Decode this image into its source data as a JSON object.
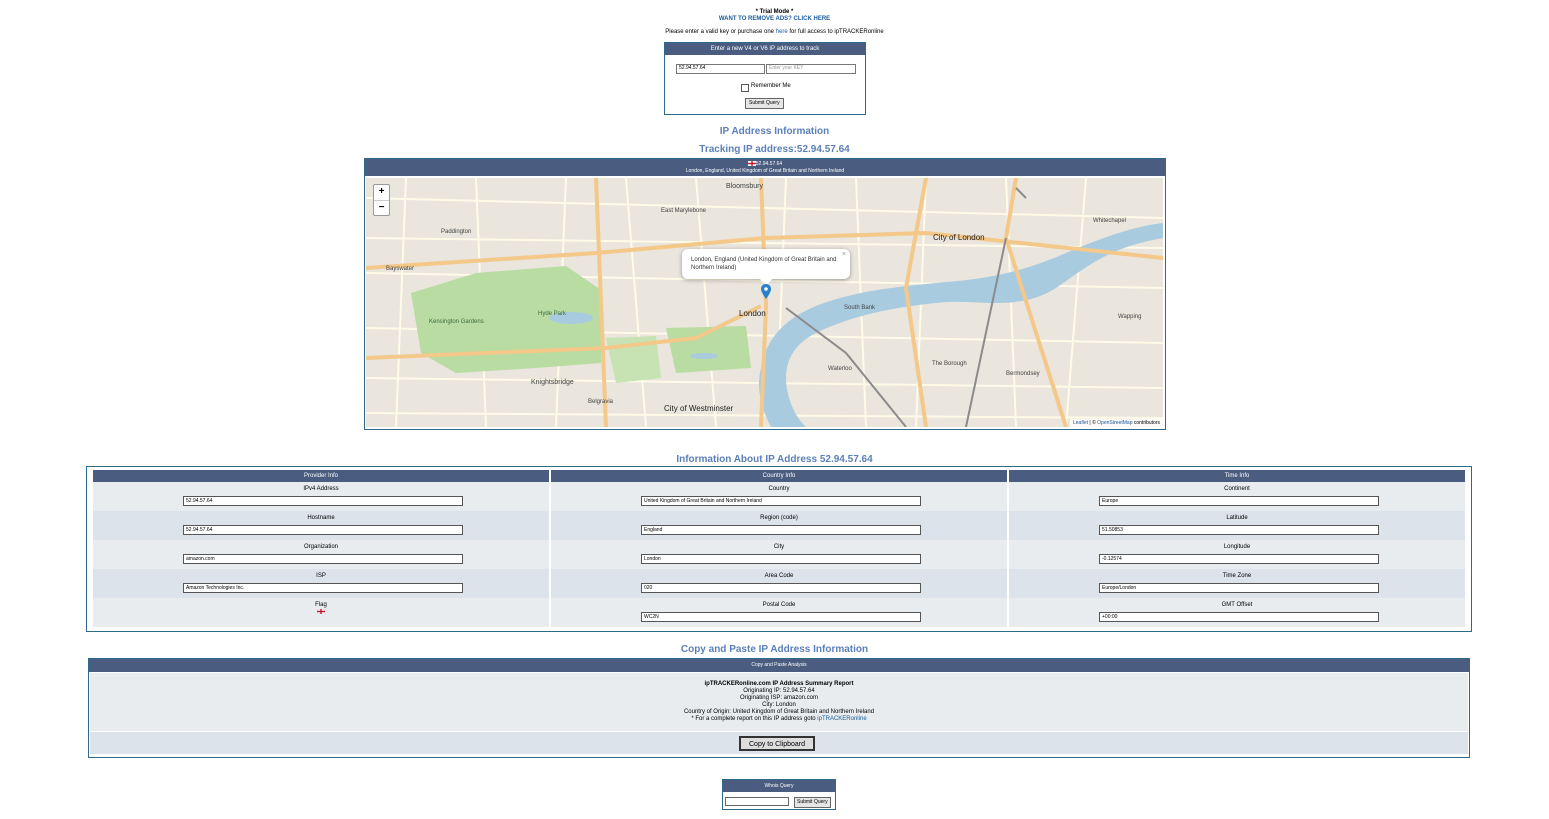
{
  "trial": {
    "title": "* Trial Mode *",
    "ads_link": "WANT TO REMOVE ADS? CLICK HERE",
    "notice_before": "Please enter a valid key or purchase one ",
    "notice_link": "here",
    "notice_after": " for full access to ipTRACKERonline"
  },
  "track_form": {
    "header": "Enter a new V4 or V6 IP address to track",
    "ip_value": "52.94.57.64",
    "key_placeholder": "Enter your KEY",
    "remember_label": "Remember Me",
    "submit_label": "Submit Query"
  },
  "headings": {
    "ip_info": "IP Address Information",
    "tracking": "Tracking IP address:52.94.57.64",
    "about": "Information About IP Address 52.94.57.64",
    "copy": "Copy and Paste IP Address Information"
  },
  "map": {
    "header_ip": "52.94.57.64",
    "header_location": "London, England, United Kingdom of Great Britain and Northern Ireland",
    "zoom_in": "+",
    "zoom_out": "−",
    "popup_text": "London, England (United Kingdom of Great Britain and Northern Ireland)",
    "popup_close": "×",
    "attribution_leaflet": "Leaflet",
    "attribution_sep": " | © ",
    "attribution_osm": "OpenStreetMap",
    "attribution_rest": " contributors",
    "labels": {
      "bloomsbury": "Bloomsbury",
      "marylebone": "East Marylebone",
      "city_of_london": "City of London",
      "london": "London",
      "hyde_park": "Hyde Park",
      "kensington_gardens": "Kensington Gardens",
      "city_of_westminster": "City of Westminster",
      "south_bank": "South Bank",
      "the_borough": "The Borough",
      "bayswater": "Bayswater",
      "knightsbridge": "Knightsbridge",
      "belgravia": "Belgravia",
      "whitechapel": "Whitechapel",
      "bermondsey": "Bermondsey",
      "wapping": "Wapping",
      "paddington": "Paddington",
      "waterloo": "Waterloo"
    },
    "colors": {
      "land": "#eae5dd",
      "park": "#b9dca3",
      "water": "#a9cbe0",
      "road_major": "#f3c889",
      "road_minor": "#fffbe8",
      "marker": "#2a81cb"
    }
  },
  "info_table": {
    "columns": [
      {
        "header": "Provider Info",
        "cells": [
          {
            "label": "IPv4 Address",
            "value": "52.94.57.64"
          },
          {
            "label": "Hostname",
            "value": "52.94.57.64"
          },
          {
            "label": "Organization",
            "value": "amazon.com"
          },
          {
            "label": "ISP",
            "value": "Amazon Technologies Inc."
          },
          {
            "label": "Flag",
            "value": ""
          }
        ]
      },
      {
        "header": "Country Info",
        "cells": [
          {
            "label": "Country",
            "value": "United Kingdom of Great Britain and Northern Ireland"
          },
          {
            "label": "Region (code)",
            "value": "England"
          },
          {
            "label": "City",
            "value": "London"
          },
          {
            "label": "Area Code",
            "value": "020"
          },
          {
            "label": "Postal Code",
            "value": "WC2N"
          }
        ]
      },
      {
        "header": "Time Info",
        "cells": [
          {
            "label": "Continent",
            "value": "Europe"
          },
          {
            "label": "Latitude",
            "value": "51.50853"
          },
          {
            "label": "Longitude",
            "value": "-0.12574"
          },
          {
            "label": "Time Zone",
            "value": "Europe/London"
          },
          {
            "label": "GMT Offset",
            "value": "+00:00"
          }
        ]
      }
    ]
  },
  "copy_paste": {
    "header": "Copy and Paste Analysis",
    "report_title": "ipTRACKERonline.com IP Address Summary Report",
    "line_ip": "Originating IP: 52.94.57.64",
    "line_isp": "Originating ISP: amazon.com",
    "line_city": "City: London",
    "line_country": "Country of Origin: United Kingdom of Great Britain and Northern Ireland",
    "line_more_before": "* For a complete report on this IP address goto ",
    "line_more_link": "ipTRACKERonline",
    "button_label": "Copy to Clipboard"
  },
  "whois": {
    "header": "Whois Query",
    "submit_label": "Submit Query"
  }
}
